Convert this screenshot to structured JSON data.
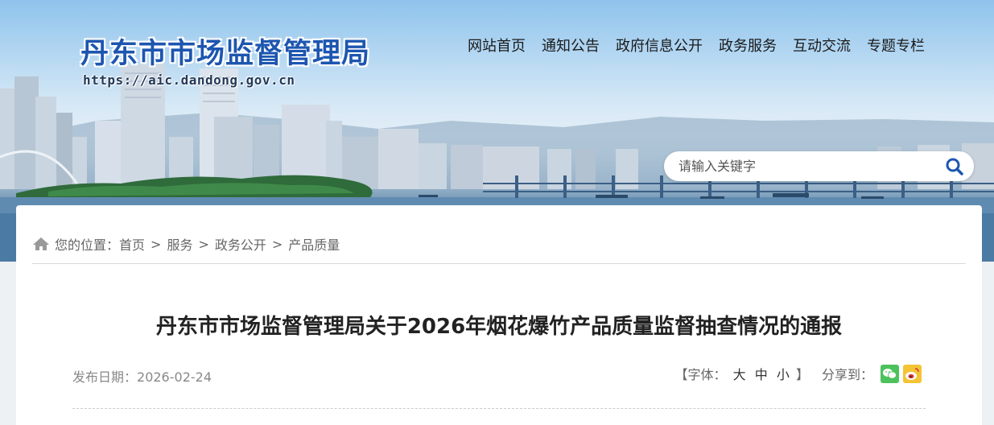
{
  "header": {
    "site_title": "丹东市市场监督管理局",
    "site_url": "https://aic.dandong.gov.cn"
  },
  "nav": {
    "items": [
      {
        "label": "网站首页"
      },
      {
        "label": "通知公告"
      },
      {
        "label": "政府信息公开"
      },
      {
        "label": "政务服务"
      },
      {
        "label": "互动交流"
      },
      {
        "label": "专题专栏"
      }
    ]
  },
  "search": {
    "placeholder": "请输入关键字",
    "icon": "search-icon"
  },
  "breadcrumb": {
    "prefix": "您的位置：",
    "items": [
      {
        "label": "首页"
      },
      {
        "label": "服务"
      },
      {
        "label": "政务公开"
      },
      {
        "label": "产品质量"
      }
    ],
    "separator": ">",
    "icon": "home-icon"
  },
  "article": {
    "title": "丹东市市场监督管理局关于2026年烟花爆竹产品质量监督抽查情况的通报",
    "publish_label": "发布日期：",
    "publish_date": "2026-02-24"
  },
  "tools": {
    "font_open": "【字体：",
    "font_large": "大",
    "font_medium": "中",
    "font_small": "小",
    "font_close": "】",
    "share_label": "分享到：",
    "share_icons": [
      "wechat-icon",
      "weibo-icon"
    ]
  },
  "colors": {
    "title_blue": "#1d56b0",
    "wechat_green": "#4dc25c",
    "weibo_yellow": "#f3c433"
  }
}
